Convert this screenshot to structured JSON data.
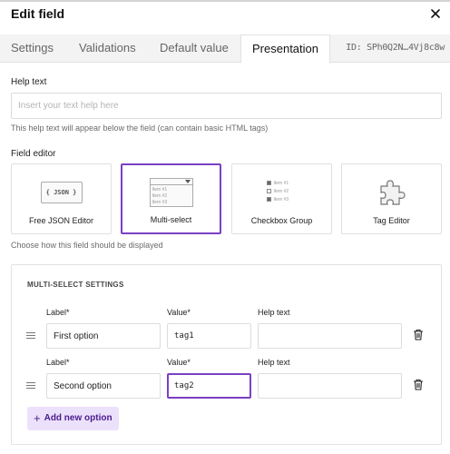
{
  "modal": {
    "title": "Edit field",
    "close_icon": "close-icon"
  },
  "tabs": [
    {
      "label": "Settings",
      "active": false
    },
    {
      "label": "Validations",
      "active": false
    },
    {
      "label": "Default value",
      "active": false
    },
    {
      "label": "Presentation",
      "active": true
    }
  ],
  "record_id": "ID: SPh0Q2N…4Vj8c8w",
  "help_text": {
    "label": "Help text",
    "placeholder": "Insert your text help here",
    "value": "",
    "hint": "This help text will appear below the field (can contain basic HTML tags)"
  },
  "field_editor": {
    "label": "Field editor",
    "hint": "Choose how this field should be displayed",
    "selected": "Multi-select",
    "options": [
      {
        "label": "Free JSON Editor",
        "icon": "json-icon",
        "icon_text": "{ JSON }"
      },
      {
        "label": "Multi-select",
        "icon": "multi-select-icon",
        "icon_items": [
          "Item #1",
          "Item #2",
          "Item #3"
        ]
      },
      {
        "label": "Checkbox Group",
        "icon": "checkbox-group-icon",
        "icon_items": [
          "Item #1",
          "Item #2",
          "Item #3"
        ]
      },
      {
        "label": "Tag Editor",
        "icon": "puzzle-icon"
      }
    ]
  },
  "multi_select_settings": {
    "title": "MULTI-SELECT SETTINGS",
    "columns": {
      "label": "Label*",
      "value": "Value*",
      "help": "Help text"
    },
    "options": [
      {
        "label": "First option",
        "value": "tag1",
        "help": ""
      },
      {
        "label": "Second option",
        "value": "tag2",
        "help": ""
      }
    ],
    "add_button": {
      "plus": "+",
      "label": "Add new option"
    }
  },
  "colors": {
    "accent": "#7b3fc4",
    "add_button_bg": "#ece1fb",
    "add_button_text": "#4a1c8c"
  }
}
